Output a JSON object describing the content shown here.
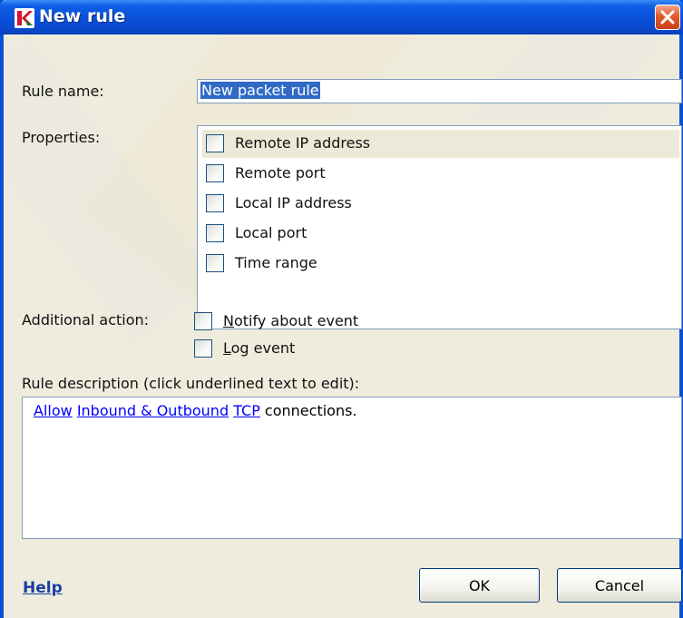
{
  "window": {
    "title": "New rule",
    "accent": "#0a4fd8",
    "close_color": "#e35a2b"
  },
  "form": {
    "rule_name_label": "Rule name:",
    "rule_name_value": "New packet rule",
    "properties_label": "Properties:",
    "properties": [
      {
        "label": "Remote IP address",
        "checked": false
      },
      {
        "label": "Remote port",
        "checked": false
      },
      {
        "label": "Local IP address",
        "checked": false
      },
      {
        "label": "Local port",
        "checked": false
      },
      {
        "label": "Time range",
        "checked": false
      }
    ],
    "additional_action_label": "Additional action:",
    "actions": [
      {
        "label": "Notify about event",
        "mnemonic": "N",
        "rest": "otify about event",
        "checked": false
      },
      {
        "label": "Log event",
        "mnemonic": "L",
        "rest": "og event",
        "checked": false
      }
    ],
    "description_label": "Rule description (click underlined text to edit):",
    "description": {
      "link1": "Allow",
      "sep1": " ",
      "link2": "Inbound & Outbound",
      "sep2": " ",
      "link3": "TCP",
      "tail": " connections."
    }
  },
  "footer": {
    "help_label": "Help",
    "ok_label": "OK",
    "cancel_label": "Cancel"
  },
  "icons": {
    "app": "kaspersky-k-icon",
    "close": "close-x-icon"
  }
}
